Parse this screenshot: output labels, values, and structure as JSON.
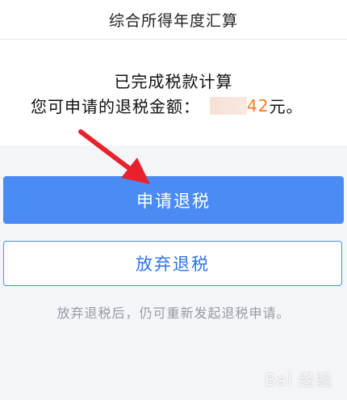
{
  "header": {
    "title": "综合所得年度汇算"
  },
  "result": {
    "status_text": "已完成税款计算",
    "refund_label": "您可申请的退税金额：",
    "refund_amount": "42",
    "refund_unit": "元。"
  },
  "actions": {
    "apply_label": "申请退税",
    "abandon_label": "放弃退税"
  },
  "hint": {
    "text": "放弃退税后，仍可重新发起退税申请。"
  },
  "watermark": {
    "text": "Bai 经验"
  },
  "colors": {
    "primary": "#4a8cf4",
    "amount": "#ff7a22",
    "arrow": "#e8222d"
  }
}
